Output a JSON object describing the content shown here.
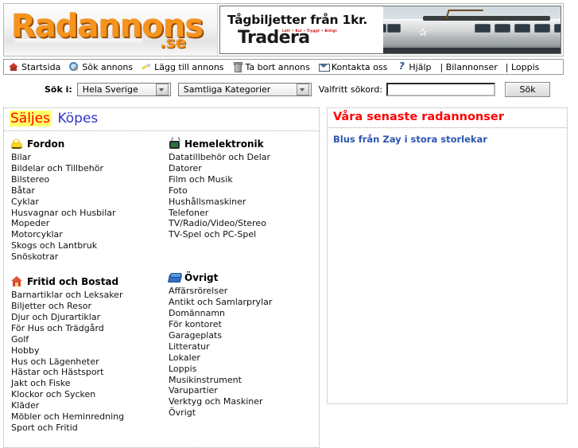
{
  "header": {
    "logo_main": "Radannons",
    "logo_tld": ".se",
    "banner": {
      "line1": "Tågbiljetter från 1kr.",
      "line2": "Tradera",
      "kicker": "Lätt • Kul • Tryggt • Billigt",
      "train_logo": "✰"
    }
  },
  "nav": {
    "items": [
      {
        "label": "Startsida",
        "icon": "house-icon"
      },
      {
        "label": "Sök annons",
        "icon": "magnifier-icon"
      },
      {
        "label": "Lägg till annons",
        "icon": "pencil-icon"
      },
      {
        "label": "Ta bort annons",
        "icon": "trash-icon"
      },
      {
        "label": "Kontakta oss",
        "icon": "envelope-icon"
      },
      {
        "label": "Hjälp",
        "icon": "help-icon"
      }
    ],
    "links": [
      {
        "label": "| Bilannonser"
      },
      {
        "label": "| Loppis"
      }
    ]
  },
  "search": {
    "label": "Sök i:",
    "region_value": "Hela Sverige",
    "category_value": "Samtliga Kategorier",
    "keyword_label": "Valfritt sökord:",
    "keyword_value": "",
    "keyword_placeholder": "",
    "button_label": "Sök"
  },
  "tabs": {
    "saljes": "Säljes",
    "kopes": "Köpes",
    "saljes_color": "#ff0000",
    "saljes_highlight": "#ffff66",
    "kopes_color": "#3333cc"
  },
  "categories": {
    "col1": [
      {
        "title": "Fordon",
        "icon": "car-icon",
        "items": [
          "Bilar",
          "Bildelar och Tillbehör",
          "Bilstereo",
          "Båtar",
          "Cyklar",
          "Husvagnar och Husbilar",
          "Mopeder",
          "Motorcyklar",
          "Skogs och Lantbruk",
          "Snöskotrar"
        ]
      },
      {
        "title": "Fritid och Bostad",
        "icon": "house-icon",
        "items": [
          "Barnartiklar och Leksaker",
          "Biljetter och Resor",
          "Djur och Djurartiklar",
          "För Hus och Trädgård",
          "Golf",
          "Hobby",
          "Hus och Lägenheter",
          "Hästar och Hästsport",
          "Jakt och Fiske",
          "Klockor och Sycken",
          "Kläder",
          "Möbler och Heminredning",
          "Sport och Fritid"
        ]
      }
    ],
    "col2": [
      {
        "title": "Hemelektronik",
        "icon": "tv-icon",
        "items": [
          "Datatillbehör och Delar",
          "Datorer",
          "Film och Musik",
          "Foto",
          "Hushållsmaskiner",
          "Telefoner",
          "TV/Radio/Video/Stereo",
          "TV-Spel och PC-Spel"
        ]
      },
      {
        "title": "Övrigt",
        "icon": "book-icon",
        "items": [
          "Affärsrörelser",
          "Antikt och Samlarprylar",
          "Domännamn",
          "För kontoret",
          "Garageplats",
          "Litteratur",
          "Lokaler",
          "Loppis",
          "Musikinstrument",
          "Varupartier",
          "Verktyg och Maskiner",
          "Övrigt"
        ]
      }
    ]
  },
  "latest": {
    "title": "Våra senaste radannonser",
    "items": [
      "Blus från Zay i stora storlekar"
    ]
  }
}
